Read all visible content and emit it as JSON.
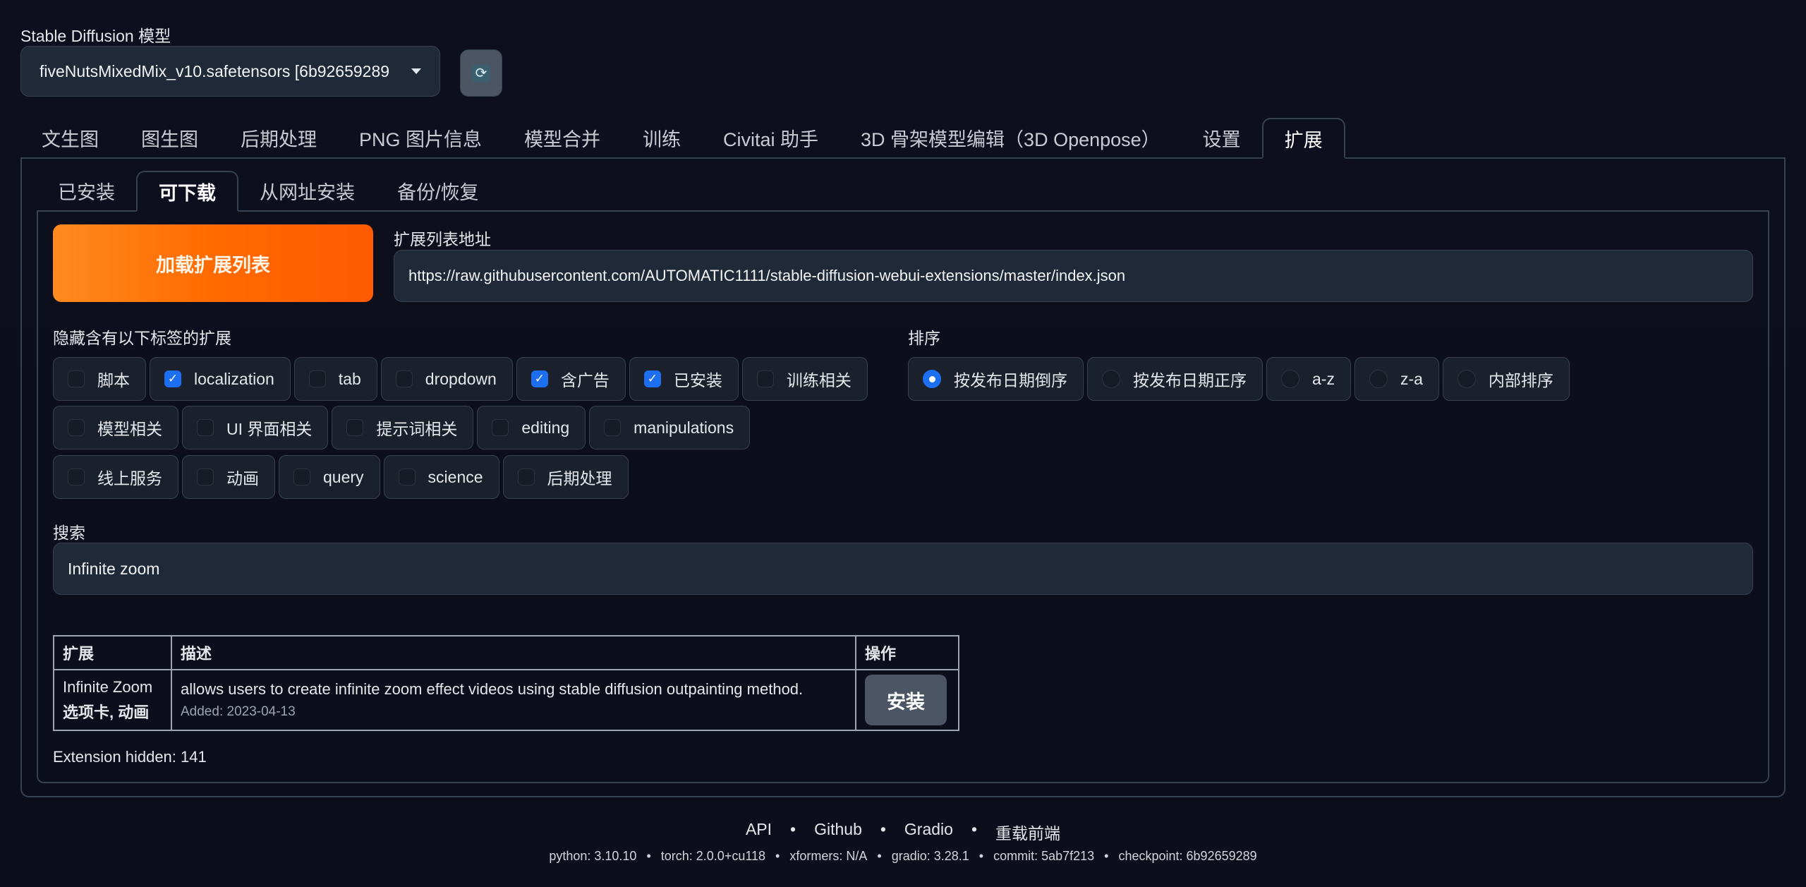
{
  "model": {
    "label": "Stable Diffusion 模型",
    "selected": "fiveNutsMixedMix_v10.safetensors [6b92659289",
    "refresh_icon": "refresh-icon"
  },
  "main_tabs": [
    {
      "label": "文生图",
      "active": false
    },
    {
      "label": "图生图",
      "active": false
    },
    {
      "label": "后期处理",
      "active": false
    },
    {
      "label": "PNG 图片信息",
      "active": false
    },
    {
      "label": "模型合并",
      "active": false
    },
    {
      "label": "训练",
      "active": false
    },
    {
      "label": "Civitai 助手",
      "active": false
    },
    {
      "label": "3D 骨架模型编辑（3D Openpose）",
      "active": false
    },
    {
      "label": "设置",
      "active": false
    },
    {
      "label": "扩展",
      "active": true
    }
  ],
  "sub_tabs": [
    {
      "label": "已安装",
      "active": false
    },
    {
      "label": "可下载",
      "active": true
    },
    {
      "label": "从网址安装",
      "active": false
    },
    {
      "label": "备份/恢复",
      "active": false
    }
  ],
  "load_button": "加载扩展列表",
  "url": {
    "label": "扩展列表地址",
    "value": "https://raw.githubusercontent.com/AUTOMATIC1111/stable-diffusion-webui-extensions/master/index.json"
  },
  "hide_tags": {
    "label": "隐藏含有以下标签的扩展",
    "rows": [
      [
        {
          "label": "脚本",
          "checked": false
        },
        {
          "label": "localization",
          "checked": true
        },
        {
          "label": "tab",
          "checked": false
        },
        {
          "label": "dropdown",
          "checked": false
        },
        {
          "label": "含广告",
          "checked": true
        },
        {
          "label": "已安装",
          "checked": true
        },
        {
          "label": "训练相关",
          "checked": false
        }
      ],
      [
        {
          "label": "模型相关",
          "checked": false
        },
        {
          "label": "UI 界面相关",
          "checked": false
        },
        {
          "label": "提示词相关",
          "checked": false
        },
        {
          "label": "editing",
          "checked": false
        },
        {
          "label": "manipulations",
          "checked": false
        }
      ],
      [
        {
          "label": "线上服务",
          "checked": false
        },
        {
          "label": "动画",
          "checked": false
        },
        {
          "label": "query",
          "checked": false
        },
        {
          "label": "science",
          "checked": false
        },
        {
          "label": "后期处理",
          "checked": false
        }
      ]
    ]
  },
  "sort": {
    "label": "排序",
    "options": [
      {
        "label": "按发布日期倒序",
        "selected": true
      },
      {
        "label": "按发布日期正序",
        "selected": false
      },
      {
        "label": "a-z",
        "selected": false
      },
      {
        "label": "z-a",
        "selected": false
      },
      {
        "label": "内部排序",
        "selected": false
      }
    ]
  },
  "search": {
    "label": "搜索",
    "value": "Infinite zoom"
  },
  "table": {
    "headers": [
      "扩展",
      "描述",
      "操作"
    ],
    "rows": [
      {
        "name": "Infinite Zoom",
        "tags": "选项卡, 动画",
        "description": "allows users to create infinite zoom effect videos using stable diffusion outpainting method.",
        "added": "Added: 2023-04-13",
        "action": "安装"
      }
    ]
  },
  "hidden_count_text": "Extension hidden: 141",
  "footer": {
    "links": [
      "API",
      "Github",
      "Gradio",
      "重载前端"
    ],
    "link_separator": "•",
    "versions": [
      "python: 3.10.10",
      "torch: 2.0.0+cu118",
      "xformers: N/A",
      "gradio: 3.28.1",
      "commit: 5ab7f213",
      "checkpoint: 6b92659289"
    ]
  },
  "colors": {
    "background": "#0d0f1e",
    "accent_orange": "#ff6a00",
    "checkbox_blue": "#1d6ff2",
    "input_bg": "#1f2937",
    "border": "#374151"
  }
}
